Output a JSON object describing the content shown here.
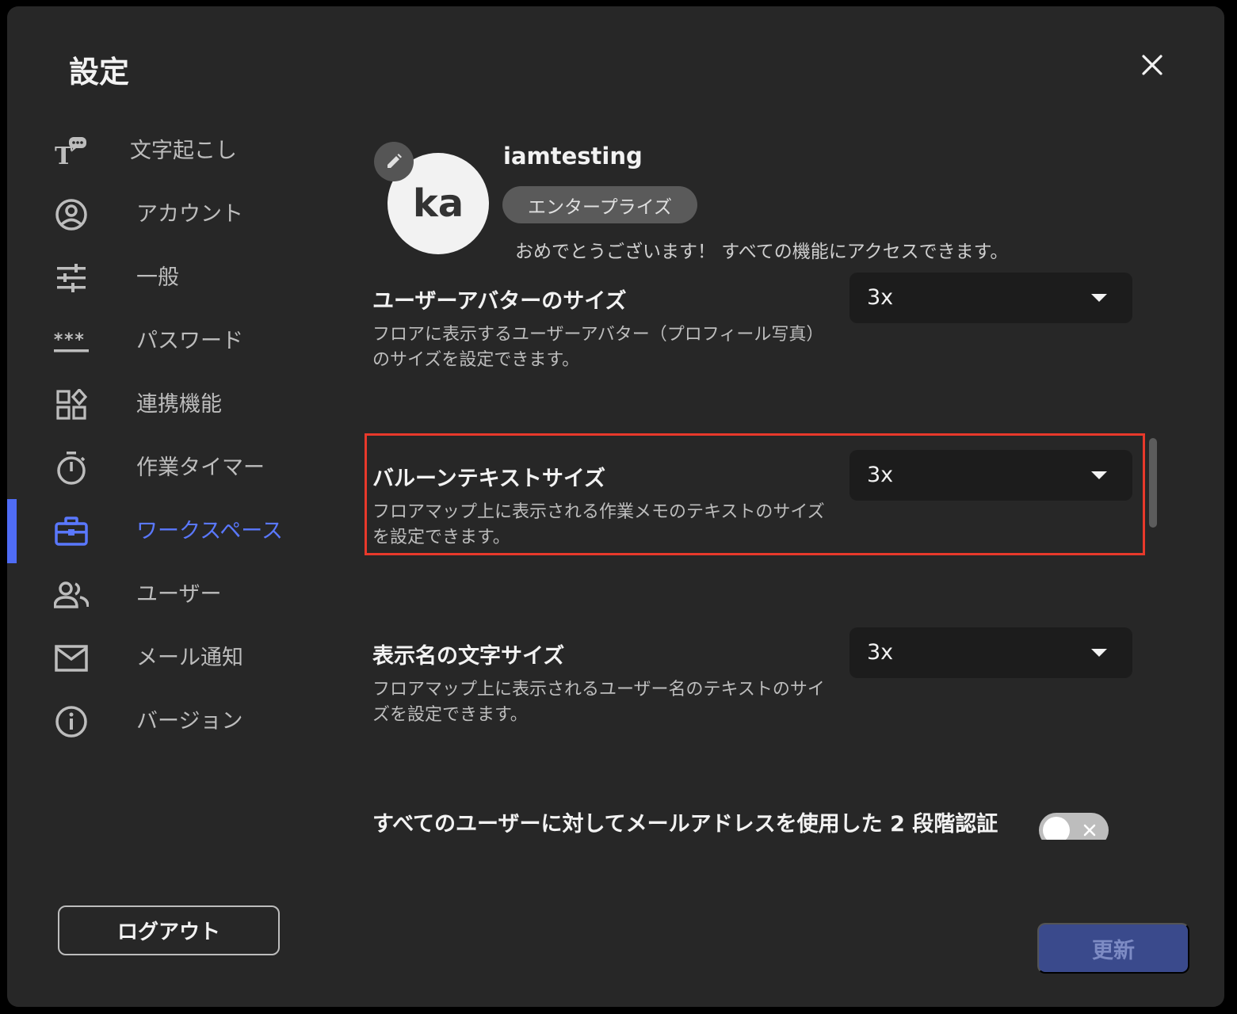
{
  "dialog": {
    "title": "設定",
    "close_icon": "close-icon"
  },
  "sidebar": {
    "items": [
      {
        "label": "文字起こし",
        "icon": "transcription-icon"
      },
      {
        "label": "アカウント",
        "icon": "account-icon"
      },
      {
        "label": "一般",
        "icon": "sliders-icon"
      },
      {
        "label": "パスワード",
        "icon": "password-icon"
      },
      {
        "label": "連携機能",
        "icon": "integrations-icon"
      },
      {
        "label": "作業タイマー",
        "icon": "timer-icon"
      },
      {
        "label": "ワークスペース",
        "icon": "briefcase-icon",
        "active": true
      },
      {
        "label": "ユーザー",
        "icon": "users-icon"
      },
      {
        "label": "メール通知",
        "icon": "mail-icon"
      },
      {
        "label": "バージョン",
        "icon": "info-icon"
      }
    ],
    "logout_label": "ログアウト",
    "active_color": "#5a78ff"
  },
  "profile": {
    "avatar_initials": "ka",
    "username": "iamtesting",
    "plan": "エンタープライズ",
    "message": "おめでとうございます！ すべての機能にアクセスできます。"
  },
  "settings": {
    "avatar_size": {
      "title": "ユーザーアバターのサイズ",
      "description": "フロアに表示するユーザーアバター（プロフィール写真）のサイズを設定できます。",
      "value": "3x"
    },
    "balloon_text_size": {
      "title": "バルーンテキストサイズ",
      "description": "フロアマップ上に表示される作業メモのテキストのサイズを設定できます。",
      "value": "3x"
    },
    "display_name_size": {
      "title": "表示名の文字サイズ",
      "description": "フロアマップ上に表示されるユーザー名のテキストのサイズを設定できます。",
      "value": "3x"
    },
    "two_factor": {
      "title": "すべてのユーザーに対してメールアドレスを使用した 2 段階認証",
      "enabled": false
    }
  },
  "footer": {
    "update_label": "更新"
  },
  "colors": {
    "highlight": "#e8392b",
    "update_button": "#3a4a8c"
  }
}
